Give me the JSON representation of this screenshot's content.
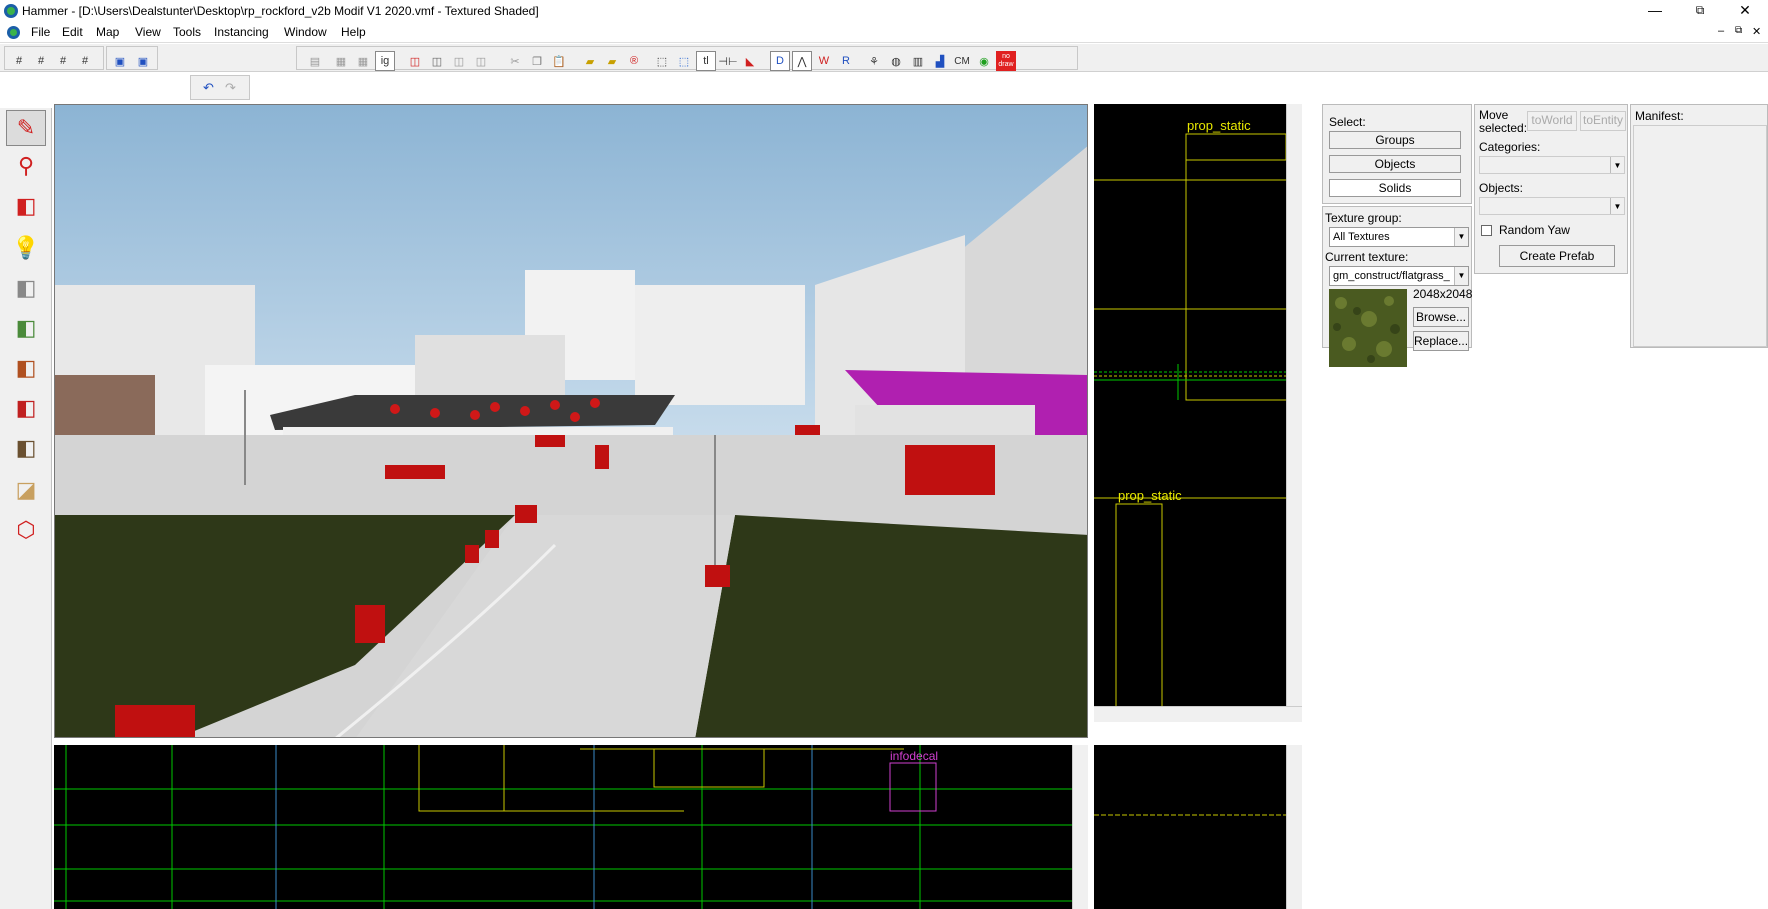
{
  "window": {
    "title": "Hammer - [D:\\Users\\Dealstunter\\Desktop\\rp_rockford_v2b Modif V1 2020.vmf - Textured Shaded]",
    "minimize": "—",
    "maximize": "⧉",
    "close": "✕",
    "child_min": "–",
    "child_restore": "⧉",
    "child_close": "✕"
  },
  "menu": [
    "File",
    "Edit",
    "Map",
    "View",
    "Tools",
    "Instancing",
    "Window",
    "Help"
  ],
  "toolbar": {
    "grid_text": "ig",
    "text_tool": "tl",
    "cm_label": "CM",
    "nodraw_label": "no draw"
  },
  "views": {
    "right_labels": [
      "prop_static",
      "prop_static"
    ],
    "bottom_label": "infodecal"
  },
  "panel": {
    "select_label": "Select:",
    "groups_btn": "Groups",
    "objects_btn": "Objects",
    "solids_btn": "Solids",
    "move_selected_label": "Move selected:",
    "to_world_btn": "toWorld",
    "to_entity_btn": "toEntity",
    "categories_label": "Categories:",
    "objects_label": "Objects:",
    "random_yaw_label": "Random Yaw",
    "create_prefab_btn": "Create Prefab",
    "manifest_label": "Manifest:",
    "texture_group_label": "Texture group:",
    "texture_group_value": "All Textures",
    "current_texture_label": "Current texture:",
    "current_texture_value": "gm_construct/flatgrass_",
    "texture_size": "2048x2048",
    "browse_btn": "Browse...",
    "replace_btn": "Replace..."
  },
  "colors": {
    "accent_selected": "#ff0000",
    "grid_green": "#00c800",
    "entity_yellow": "#e8e800",
    "decal_magenta": "#d040d0"
  }
}
